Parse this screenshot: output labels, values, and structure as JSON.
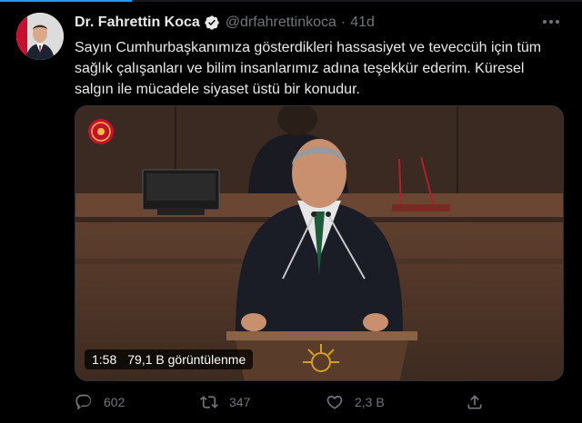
{
  "tweet": {
    "author_name": "Dr. Fahrettin Koca",
    "handle": "@drfahrettinkoca",
    "separator": "·",
    "time": "41d",
    "text_lines": [
      "Sayın Cumhurbaşkanımıza gösterdikleri hassasiyet ve teveccüh için tüm",
      "sağlık çalışanları ve bilim insanlarımız adına teşekkür ederim. Küresel",
      "salgın ile mücadele siyaset üstü bir konudur."
    ]
  },
  "video": {
    "duration": "1:58",
    "views": "79,1 B görüntülenme"
  },
  "actions": {
    "reply_count": "602",
    "retweet_count": "347",
    "like_count": "2,3 B"
  },
  "icons": {
    "verified": "verified-badge-icon",
    "more": "more-dots-icon",
    "reply": "reply-icon",
    "retweet": "retweet-icon",
    "like": "heart-icon",
    "share": "share-icon"
  },
  "colors": {
    "background": "#000000",
    "text": "#e7e9ea",
    "secondary": "#71767b",
    "accent": "#1d9bf0",
    "verified": "#e7e9ea"
  }
}
